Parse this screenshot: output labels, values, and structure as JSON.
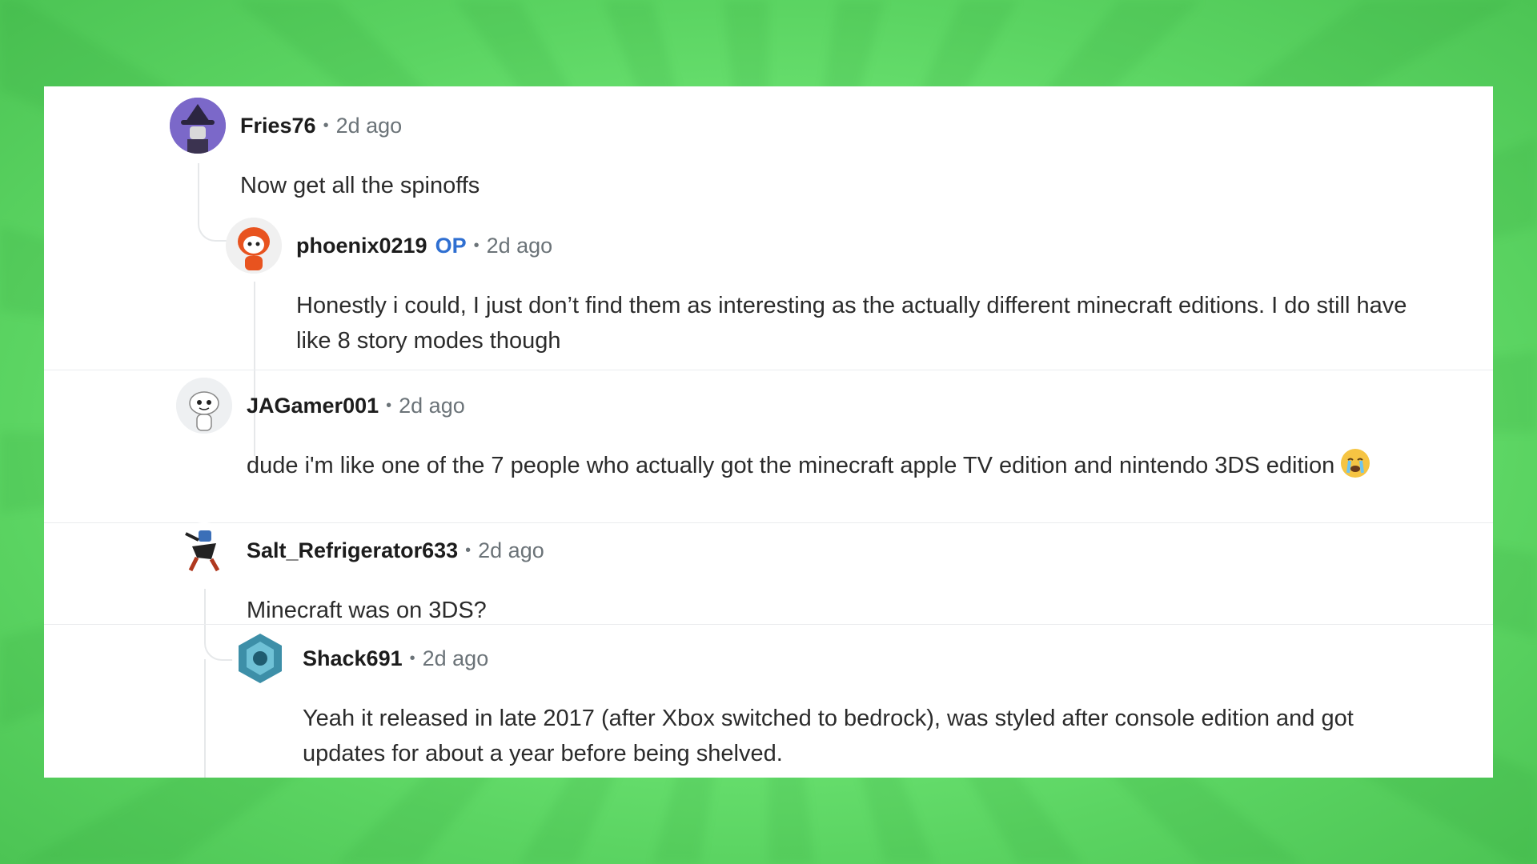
{
  "comments": [
    {
      "username": "Fries76",
      "time": "2d ago",
      "text": "Now get all the spinoffs",
      "avatar_icon": "wizard-avatar-icon"
    },
    {
      "username": "phoenix0219",
      "badge": "OP",
      "time": "2d ago",
      "text": "Honestly i could, I just don’t find them as interesting as the actually different minecraft editions. I do still have like 8 story modes though",
      "avatar_icon": "snoo-orange-avatar-icon"
    },
    {
      "username": "JAGamer001",
      "time": "2d ago",
      "text": "dude i'm like one of the 7 people who actually got the minecraft apple TV edition and nintendo 3DS edition",
      "emoji": "crying-face",
      "avatar_icon": "snoo-white-avatar-icon"
    },
    {
      "username": "Salt_Refrigerator633",
      "time": "2d ago",
      "text": "Minecraft was on 3DS?",
      "avatar_icon": "robot-avatar-icon"
    },
    {
      "username": "Shack691",
      "time": "2d ago",
      "text": "Yeah it released in late 2017 (after Xbox switched to bedrock), was styled after console edition and got updates for about a year before being shelved.",
      "avatar_icon": "hexagon-avatar-icon"
    }
  ],
  "separator": "•",
  "colors": {
    "accent_op": "#2f6fd1",
    "background": "#74ea7a",
    "panel": "#ffffff"
  }
}
